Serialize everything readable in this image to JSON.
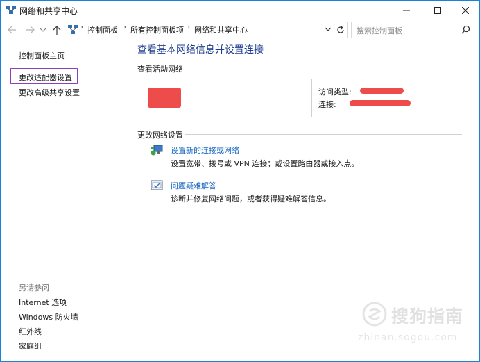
{
  "window": {
    "title": "网络和共享中心",
    "accent": "#1883d7"
  },
  "address_bar": {
    "crumbs": [
      "控制面板",
      "所有控制面板项",
      "网络和共享中心"
    ],
    "search_placeholder": "搜索控制面板"
  },
  "left_pane": {
    "home": "控制面板主页",
    "adapter": "更改适配器设置",
    "advanced_sharing": "更改高级共享设置",
    "see_also_heading": "另请参阅",
    "see_also": [
      "Internet 选项",
      "Windows 防火墙",
      "红外线",
      "家庭组"
    ],
    "highlight_color": "#8a3fbf"
  },
  "main": {
    "title": "查看基本网络信息并设置连接",
    "active_networks_heading": "查看活动网络",
    "access_type_label": "访问类型:",
    "connections_label": "连接:",
    "change_settings_heading": "更改网络设置",
    "tasks": [
      {
        "link": "设置新的连接或网络",
        "desc": "设置宽带、拨号或 VPN 连接；或设置路由器或接入点。",
        "icon": "new-connection-icon"
      },
      {
        "link": "问题疑难解答",
        "desc": "诊断并修复网络问题，或者获得疑难解答信息。",
        "icon": "troubleshoot-icon"
      }
    ],
    "redaction_color": "#ee4b4b"
  },
  "watermark": {
    "brand": "搜狗指南",
    "url": "zhinan.sogou.com"
  }
}
